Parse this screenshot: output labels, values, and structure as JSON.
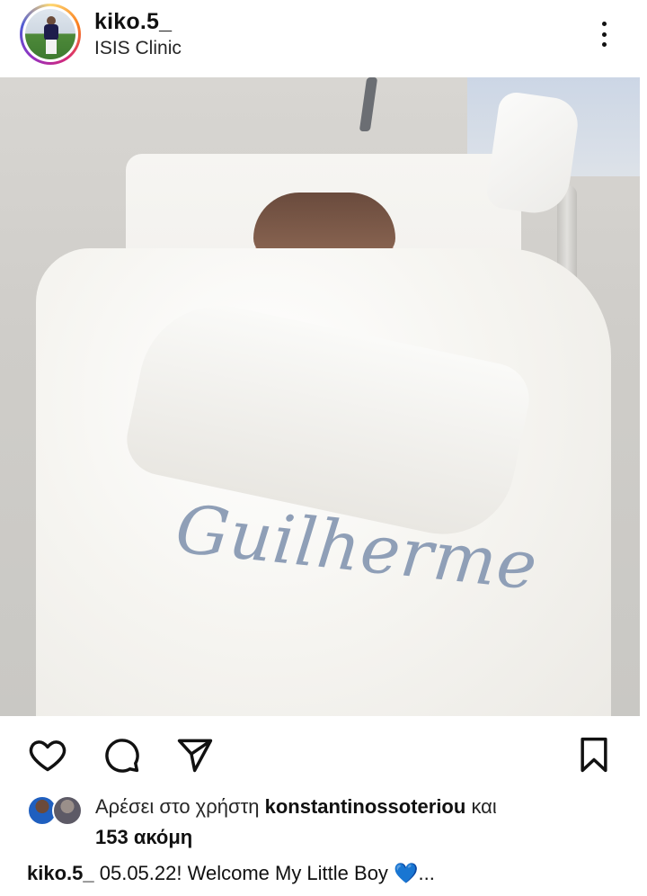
{
  "post": {
    "username": "kiko.5_",
    "location": "ISIS Clinic"
  },
  "image": {
    "embroidered_name": "Guilherme"
  },
  "actions": {
    "like_icon": "heart-outline-icon",
    "comment_icon": "comment-bubble-icon",
    "share_icon": "paper-plane-icon",
    "save_icon": "bookmark-icon"
  },
  "likes": {
    "prefix": "Αρέσει στο χρήστη",
    "user": "konstantinossoteriou",
    "connector": "και",
    "others": "153 ακόμη"
  },
  "caption": {
    "username": "kiko.5_",
    "text": "05.05.22! Welcome My Little Boy",
    "emoji": "💙",
    "more": "..."
  },
  "colors": {
    "emoji_blue": "#38a5ff",
    "text": "#111111"
  }
}
